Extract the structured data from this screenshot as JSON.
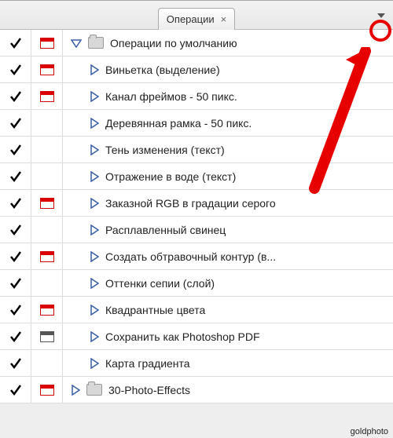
{
  "panel": {
    "tab_title": "Операции",
    "close_glyph": "×"
  },
  "sets": [
    {
      "label": "Операции по умолчанию",
      "expanded": true,
      "checked": true,
      "dialog": "red",
      "indent": 1,
      "type": "folder",
      "items": [
        {
          "label": "Виньетка (выделение)",
          "checked": true,
          "dialog": "red"
        },
        {
          "label": "Канал фреймов - 50 пикс.",
          "checked": true,
          "dialog": "red"
        },
        {
          "label": "Деревянная рамка - 50 пикс.",
          "checked": true,
          "dialog": "none"
        },
        {
          "label": "Тень изменения (текст)",
          "checked": true,
          "dialog": "none"
        },
        {
          "label": "Отражение в воде (текст)",
          "checked": true,
          "dialog": "none"
        },
        {
          "label": "Заказной RGB в градации серого",
          "checked": true,
          "dialog": "red"
        },
        {
          "label": "Расплавленный свинец",
          "checked": true,
          "dialog": "none"
        },
        {
          "label": "Создать обтравочный контур (в...",
          "checked": true,
          "dialog": "red"
        },
        {
          "label": "Оттенки сепии (слой)",
          "checked": true,
          "dialog": "none"
        },
        {
          "label": "Квадрантные цвета",
          "checked": true,
          "dialog": "red"
        },
        {
          "label": "Сохранить как Photoshop PDF",
          "checked": true,
          "dialog": "gray"
        },
        {
          "label": "Карта градиента",
          "checked": true,
          "dialog": "none"
        }
      ]
    },
    {
      "label": "30-Photo-Effects",
      "expanded": false,
      "checked": true,
      "dialog": "red",
      "indent": 1,
      "type": "folder",
      "items": []
    }
  ],
  "watermark": "goldphoto"
}
